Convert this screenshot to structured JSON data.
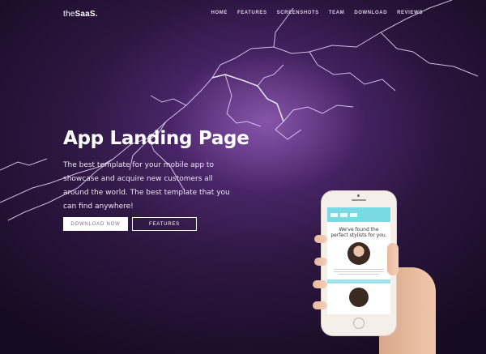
{
  "nav": {
    "logo_prefix": "the",
    "logo_brand": "SaaS.",
    "items": [
      "HOME",
      "FEATURES",
      "SCREENSHOTS",
      "TEAM",
      "DOWNLOAD",
      "REVIEWS"
    ]
  },
  "hero": {
    "title": "App Landing Page",
    "description": "The best template for your mobile app to showcase and acquire new customers all around the world. The best template that you can find anywhere!",
    "primary_button": "DOWNLOAD NOW",
    "secondary_button": "FEATURES"
  },
  "phone_screen": {
    "headline_line1": "We've found the",
    "headline_line2": "perfect stylists for you."
  },
  "colors": {
    "background": "#2c1640",
    "accent_screen": "#7ad9e3",
    "button_text": "#7c6a8c"
  }
}
